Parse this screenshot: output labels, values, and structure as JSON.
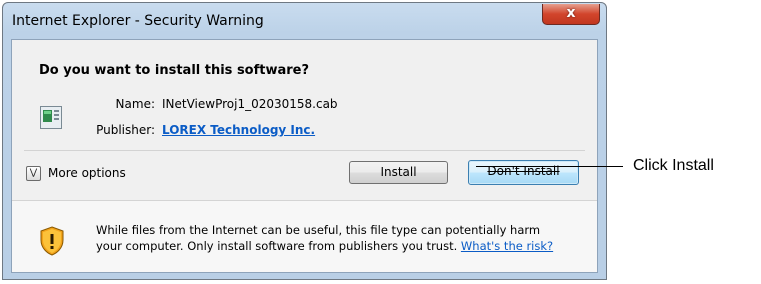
{
  "window": {
    "title": "Internet Explorer - Security Warning",
    "close_glyph": "x"
  },
  "dialog": {
    "heading": "Do you want to install this software?",
    "name_label": "Name:",
    "name_value": "INetViewProj1_02030158.cab",
    "publisher_label": "Publisher:",
    "publisher_value": "LOREX Technology Inc.",
    "more_options_label": "More options",
    "install_label": "Install",
    "dont_install_label": "Don't Install"
  },
  "warning": {
    "line1": "While files from the Internet can be useful, this file type can potentially harm",
    "line2": "your computer. Only install software from publishers you trust.",
    "risk_link": "What's the risk?"
  },
  "callout": {
    "label": "Click Install"
  },
  "icons": {
    "file": "file-icon",
    "shield": "shield-warning-icon",
    "more": "chevron-down-icon"
  }
}
